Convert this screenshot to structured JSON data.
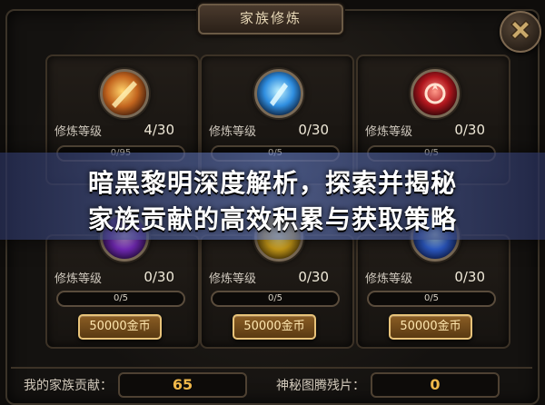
{
  "window": {
    "title": "家族修炼"
  },
  "banner": {
    "line1": "暗黑黎明深度解析，探索并揭秘",
    "line2": "家族贡献的高效积累与获取策略"
  },
  "skills_top": [
    {
      "icon": "sword-slash-icon",
      "level_label": "修炼等级",
      "level": "4/30",
      "progress_text": "0/95",
      "progress_fraction": 0.0
    },
    {
      "icon": "ice-blade-icon",
      "level_label": "修炼等级",
      "level": "0/30",
      "progress_text": "0/5",
      "progress_fraction": 0.0
    },
    {
      "icon": "crimson-emblem-icon",
      "level_label": "修炼等级",
      "level": "0/30",
      "progress_text": "0/5",
      "progress_fraction": 0.0
    }
  ],
  "skills_bottom": [
    {
      "icon": "purple-orb-icon",
      "level_label": "修炼等级",
      "level": "0/30",
      "progress_text": "0/5",
      "progress_fraction": 0.0,
      "cost_label": "50000金币"
    },
    {
      "icon": "gold-orb-icon",
      "level_label": "修炼等级",
      "level": "0/30",
      "progress_text": "0/5",
      "progress_fraction": 0.0,
      "cost_label": "50000金币"
    },
    {
      "icon": "blue-arrow-icon",
      "level_label": "修炼等级",
      "level": "0/30",
      "progress_text": "0/5",
      "progress_fraction": 0.0,
      "cost_label": "50000金币"
    }
  ],
  "footer": {
    "contribution_label": "我的家族贡献：",
    "contribution_value": "65",
    "fragments_label": "神秘图腾残片：",
    "fragments_value": "0"
  },
  "colors": {
    "gold_accent": "#f0b84a",
    "panel_border": "#3c3226",
    "banner_blue": "#5a6eaa"
  }
}
